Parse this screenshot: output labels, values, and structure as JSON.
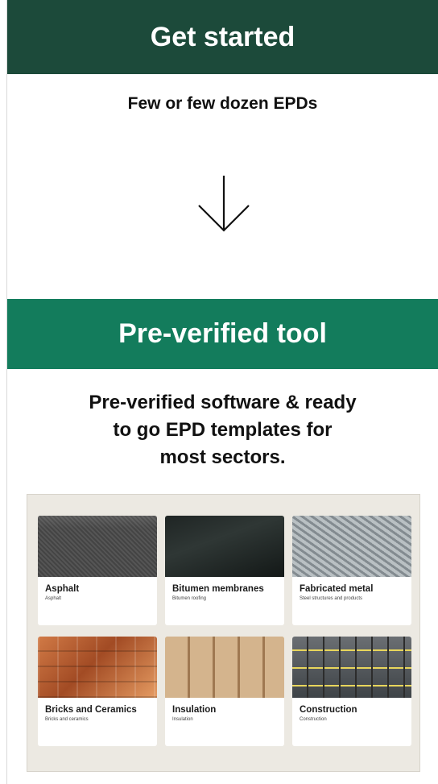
{
  "sections": {
    "get_started": {
      "title": "Get started",
      "subtitle": "Few or few dozen EPDs"
    },
    "pre_verified": {
      "title": "Pre-verified tool",
      "subtitle_lines": [
        "Pre-verified software & ready",
        "to go EPD templates for",
        "most sectors."
      ]
    }
  },
  "cards": [
    {
      "title": "Asphalt",
      "subtitle": "Asphalt",
      "image": "asphalt-paving-photo"
    },
    {
      "title": "Bitumen membranes",
      "subtitle": "Bitumen roofing",
      "image": "bitumen-membrane-photo"
    },
    {
      "title": "Fabricated metal",
      "subtitle": "Steel structures and products",
      "image": "metal-profiles-photo"
    },
    {
      "title": "Bricks and Ceramics",
      "subtitle": "Bricks and ceramics",
      "image": "bricks-photo"
    },
    {
      "title": "Insulation",
      "subtitle": "Insulation",
      "image": "insulation-photo"
    },
    {
      "title": "Construction",
      "subtitle": "Construction",
      "image": "scaffolding-photo"
    }
  ],
  "colors": {
    "header_dark_green": "#1c4a3a",
    "header_green": "#137c5c",
    "panel_bg": "#ece9e2"
  },
  "icons": {
    "arrow": "arrow-down-icon"
  }
}
